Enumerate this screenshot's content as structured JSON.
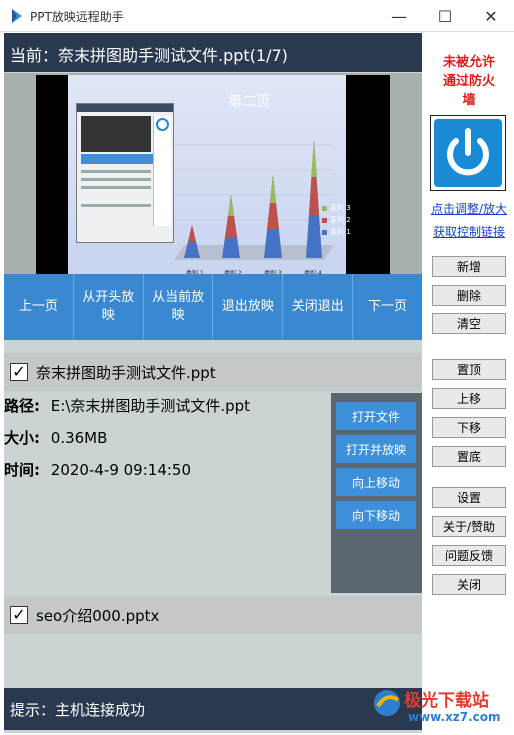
{
  "window": {
    "title": "PPT放映远程助手",
    "minimize": "—",
    "maximize": "☐",
    "close": "✕"
  },
  "current": {
    "text": "当前：奈末拼图助手测试文件.ppt(1/7)"
  },
  "slide": {
    "title": "第二页",
    "categories": [
      "类别 1",
      "类别 2",
      "类别 3",
      "类别 4"
    ],
    "legend": [
      "系列 3",
      "系列 2",
      "系列 1"
    ],
    "colors": {
      "s1": "#4472c4",
      "s2": "#c0504d",
      "s3": "#9bbb59"
    }
  },
  "nav": {
    "prev": "上一页",
    "from_start": "从开头放映",
    "from_current": "从当前放映",
    "exit": "退出放映",
    "close_exit": "关闭退出",
    "next": "下一页"
  },
  "files": [
    {
      "checked": true,
      "name": "奈末拼图助手测试文件.ppt"
    },
    {
      "checked": true,
      "name": "seo介绍000.pptx"
    }
  ],
  "detail": {
    "path_label": "路径:",
    "path_value": "E:\\奈末拼图助手测试文件.ppt",
    "size_label": "大小:",
    "size_value": "0.36MB",
    "time_label": "时间:",
    "time_value": "2020-4-9 09:14:50"
  },
  "actions": {
    "open": "打开文件",
    "open_play": "打开并放映",
    "move_up": "向上移动",
    "move_down": "向下移动"
  },
  "hint": {
    "text": "提示：主机连接成功"
  },
  "sidebar": {
    "warning": [
      "未被允许",
      "通过防火",
      "墙"
    ],
    "power_icon": "power-icon",
    "link_adjust": "点击调整/放大",
    "link_get": "获取控制链接",
    "buttons_group1": [
      "新增",
      "删除",
      "清空"
    ],
    "buttons_group2": [
      "置顶",
      "上移",
      "下移",
      "置底"
    ],
    "buttons_group3": [
      "设置",
      "关于/赞助",
      "问题反馈",
      "关闭"
    ]
  },
  "watermark": {
    "text": "极光下载站",
    "url": "www.xz7.com"
  },
  "colors": {
    "accent": "#3c8fd8",
    "header_bg": "#2a3850",
    "warning": "#e41a1a",
    "link": "#1a3fcf"
  }
}
